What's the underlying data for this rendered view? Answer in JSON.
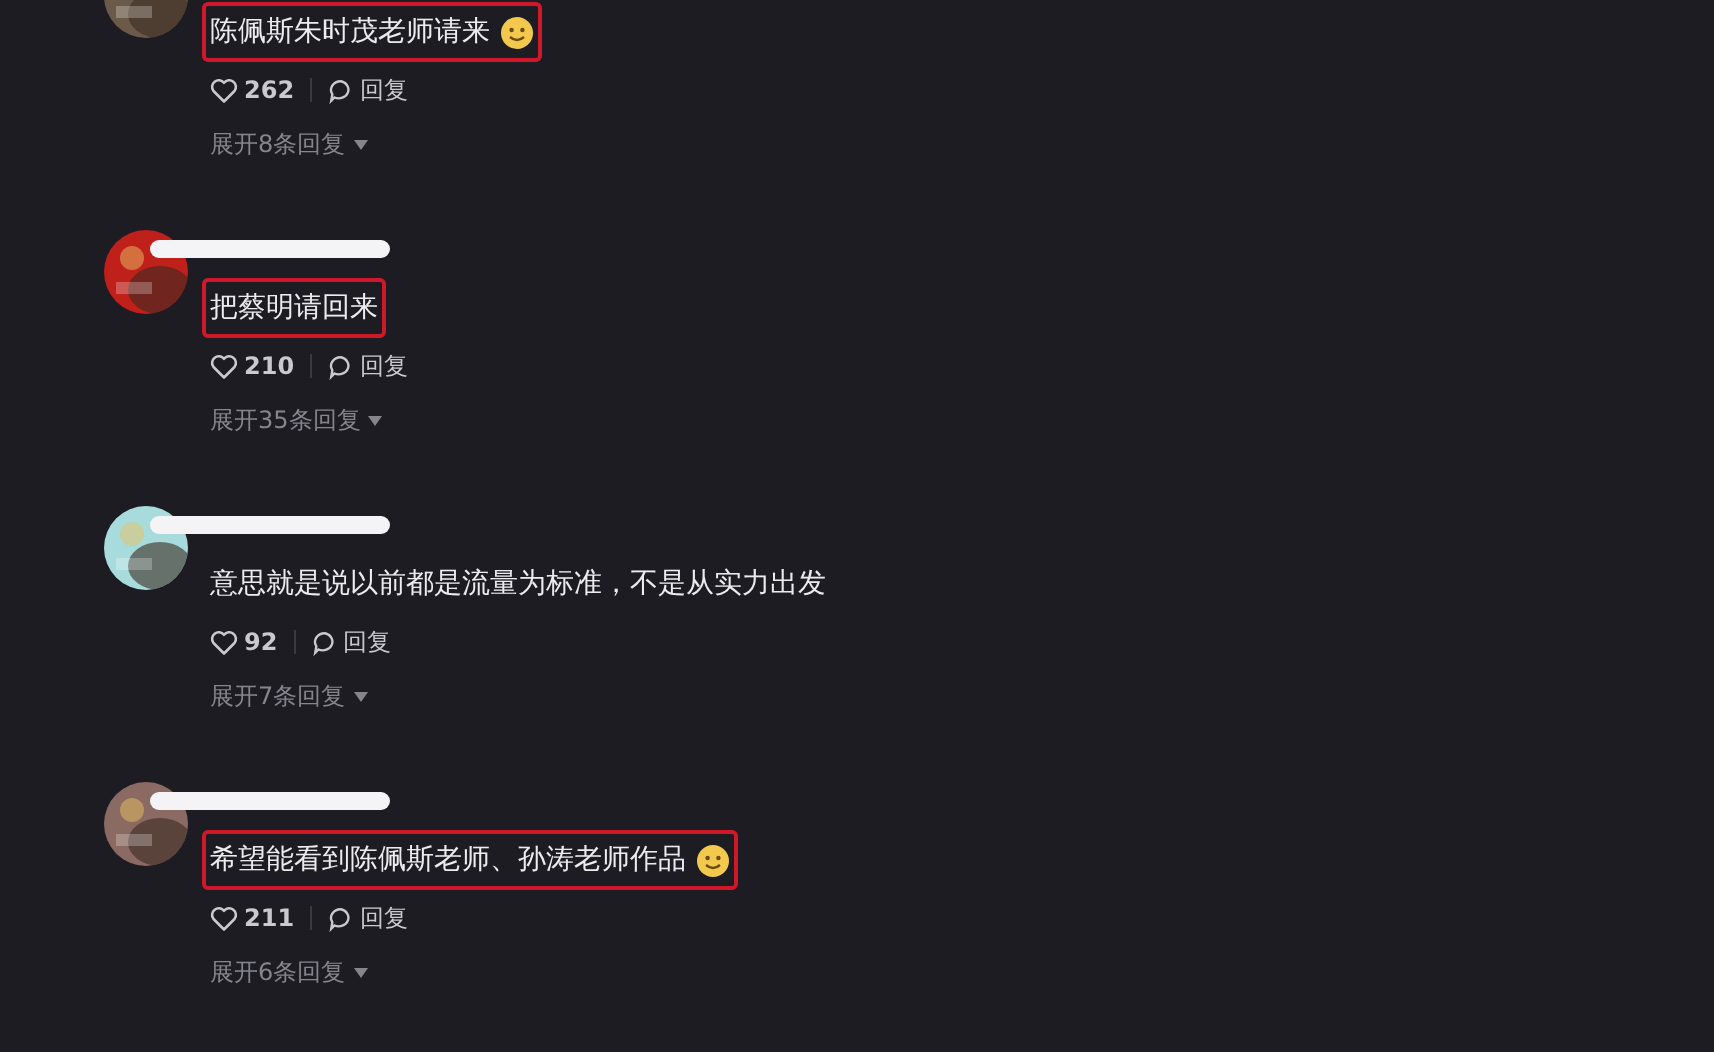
{
  "comments": [
    {
      "text": "陈佩斯朱时茂老师请来",
      "emoji": true,
      "highlighted": true,
      "likes": "262",
      "reply": "回复",
      "expand": "展开8条回复"
    },
    {
      "text": "把蔡明请回来",
      "emoji": false,
      "highlighted": true,
      "likes": "210",
      "reply": "回复",
      "expand": "展开35条回复"
    },
    {
      "text": "意思就是说以前都是流量为标准，不是从实力出发",
      "emoji": false,
      "highlighted": false,
      "likes": "92",
      "reply": "回复",
      "expand": "展开7条回复"
    },
    {
      "text": "希望能看到陈佩斯老师、孙涛老师作品",
      "emoji": true,
      "highlighted": true,
      "likes": "211",
      "reply": "回复",
      "expand": "展开6条回复"
    }
  ]
}
